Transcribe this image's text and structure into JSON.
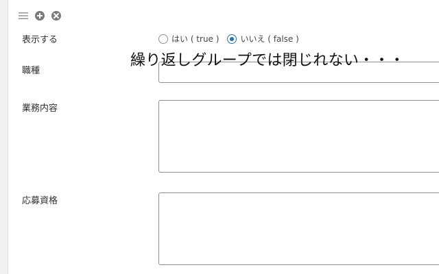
{
  "fields": {
    "show_label": "表示する",
    "show_options": [
      {
        "label": "はい ( true )",
        "checked": false
      },
      {
        "label": "いいえ ( false )",
        "checked": true
      }
    ],
    "job_type_label": "職種",
    "job_content_label": "業務内容",
    "requirements_label": "応募資格"
  },
  "annotation": "繰り返しグループでは閉じれない・・・",
  "toolbar": {
    "icons": [
      "hamburger-icon",
      "add-circle-icon",
      "close-circle-icon"
    ]
  },
  "colors": {
    "accent": "#2271b1",
    "border": "#8c8f94",
    "icon": "#7a7a7a"
  }
}
